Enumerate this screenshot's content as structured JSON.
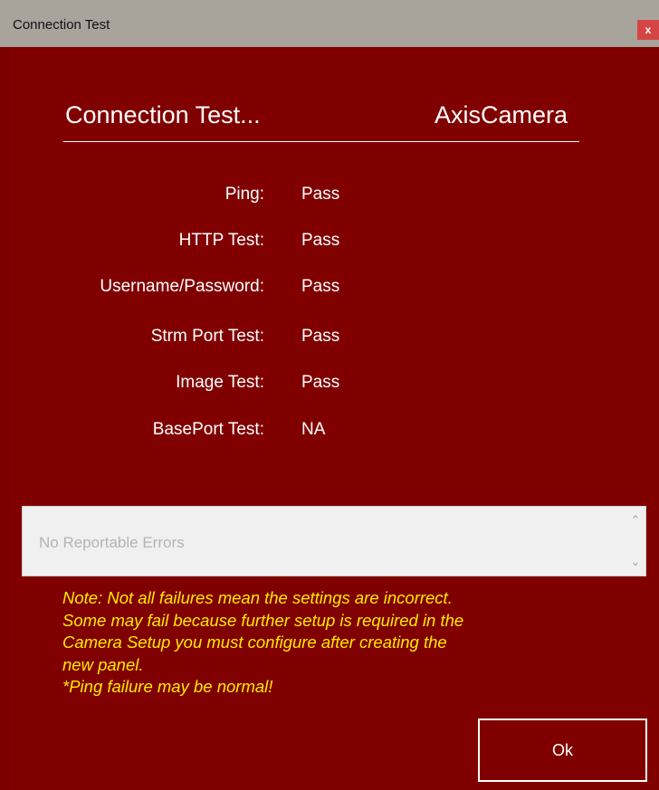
{
  "window": {
    "title": "Connection Test",
    "close_label": "x"
  },
  "header": {
    "title": "Connection Test...",
    "device": "AxisCamera"
  },
  "tests": [
    {
      "label": "Ping:",
      "result": "Pass"
    },
    {
      "label": "HTTP Test:",
      "result": "Pass"
    },
    {
      "label": "Username/Password:",
      "result": "Pass"
    },
    {
      "label": "Strm Port Test:",
      "result": "Pass"
    },
    {
      "label": "Image Test:",
      "result": "Pass"
    },
    {
      "label": "BasePort Test:",
      "result": "NA"
    }
  ],
  "errors": {
    "text": "No Reportable Errors"
  },
  "note": {
    "lines": [
      "Note: Not all failures mean the settings are incorrect.",
      "Some may fail because further setup is required in the",
      "Camera Setup you must configure after creating the",
      "new panel.",
      "*Ping failure may be normal!"
    ]
  },
  "buttons": {
    "ok_label": "Ok"
  },
  "colors": {
    "background": "#800000",
    "titlebar": "#a8a39b",
    "note_text": "#ffeb00",
    "close_button": "#d64545"
  }
}
